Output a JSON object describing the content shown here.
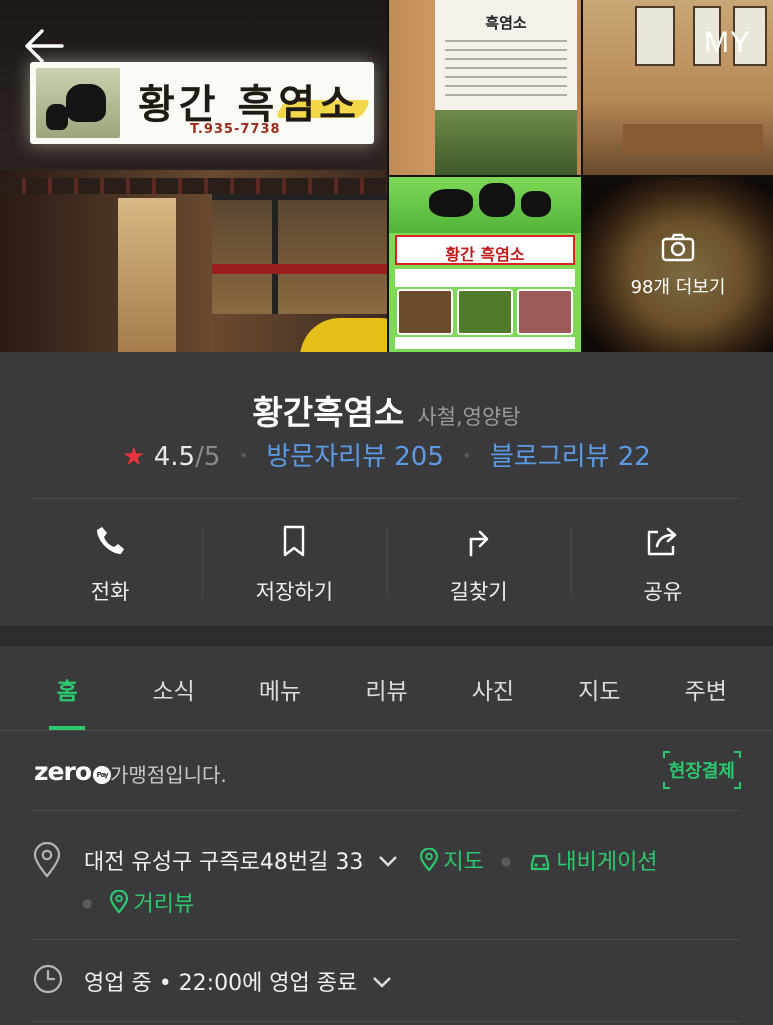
{
  "header": {
    "back_label": "←",
    "my_label": "MY"
  },
  "photos": {
    "sign_name": "황간 흑염소",
    "sign_tel": "T.935-7738",
    "poster_title": "흑염소",
    "flyer_title": "황간 흑염소",
    "more_label": "98개 더보기"
  },
  "store": {
    "name": "황간흑염소",
    "category": "사철,영양탕",
    "rating_star": "★",
    "rating": "4.5",
    "rating_max": "/5",
    "visitor_reviews": "방문자리뷰 205",
    "blog_reviews": "블로그리뷰 22",
    "separator": "•"
  },
  "actions": [
    {
      "label": "전화",
      "icon": "phone-icon"
    },
    {
      "label": "저장하기",
      "icon": "bookmark-icon"
    },
    {
      "label": "길찾기",
      "icon": "directions-icon"
    },
    {
      "label": "공유",
      "icon": "share-icon"
    }
  ],
  "tabs": [
    {
      "label": "홈",
      "active": true
    },
    {
      "label": "소식"
    },
    {
      "label": "메뉴"
    },
    {
      "label": "리뷰"
    },
    {
      "label": "사진"
    },
    {
      "label": "지도"
    },
    {
      "label": "주변"
    }
  ],
  "zeropay": {
    "logo": "zero",
    "logo_badge": "Pay",
    "text": "가맹점입니다.",
    "badge": "현장결제"
  },
  "address": {
    "text": "대전 유성구 구즉로48번길 33",
    "map_link": "지도",
    "navi_link": "내비게이션",
    "street_view": "거리뷰"
  },
  "hours": {
    "text": "영업 중 • 22:00에 영업 종료"
  },
  "colors": {
    "accent_green": "#2dc76d",
    "link_blue": "#5b9be6",
    "star_red": "#e8343d",
    "background": "#3a3a3c"
  }
}
